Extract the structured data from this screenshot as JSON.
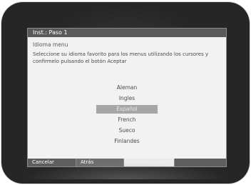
{
  "window": {
    "title": "Inst.: Paso 1"
  },
  "main": {
    "section_title": "Idioma menu",
    "instructions": "Seleccione su idioma favorito para los menus utilizando los cursores y confirmelo pulsando el botón Aceptar"
  },
  "languages": {
    "items": [
      "Aleman",
      "Ingles",
      "Español",
      "French",
      "Sueco",
      "Finlandes"
    ],
    "selected_index": 2,
    "selected": "Español"
  },
  "footer": {
    "cancel_label": "Cancelar",
    "back_label": "Atrás"
  },
  "colors": {
    "title_bar": "#595959",
    "dialog_background": "#f2f2f2",
    "selection_highlight": "#a6a6a6",
    "footer_button": "#5e5e5e"
  }
}
